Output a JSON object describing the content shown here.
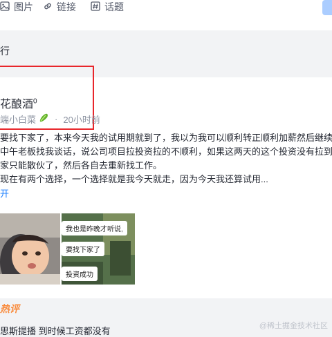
{
  "composer": {
    "tools": [
      {
        "label": "图片",
        "icon": "image-icon"
      },
      {
        "label": "链接",
        "icon": "link-icon"
      },
      {
        "label": "话题",
        "icon": "topic-icon"
      }
    ]
  },
  "section": {
    "title": "行"
  },
  "post": {
    "title": "花酿酒",
    "title_sup": "0",
    "author": "端小白菜",
    "time": "20小时前",
    "dot": "·",
    "body_lines": [
      "要找下家了，本来今天我的试用期就到了，我以为我可以顺利转正顺利加薪然后继续",
      "中午老板找我谈话，说公司项目拉投资拉的不顺利，如果这两天的这个投资没有拉到",
      "家只能散伙了，然后各自去重新找工作。",
      "现在有两个选择，一个选择就是我今天就走，因为今天我还算试用..."
    ],
    "expand_label": "开",
    "image2_captions": [
      "我也是昨晚才听说,",
      "要找下家了",
      "投资成功"
    ]
  },
  "hot_comments": {
    "label": "热评",
    "first_line": "思斯提播    到时候工资都没有"
  },
  "watermark": "@稀土掘金技术社区"
}
